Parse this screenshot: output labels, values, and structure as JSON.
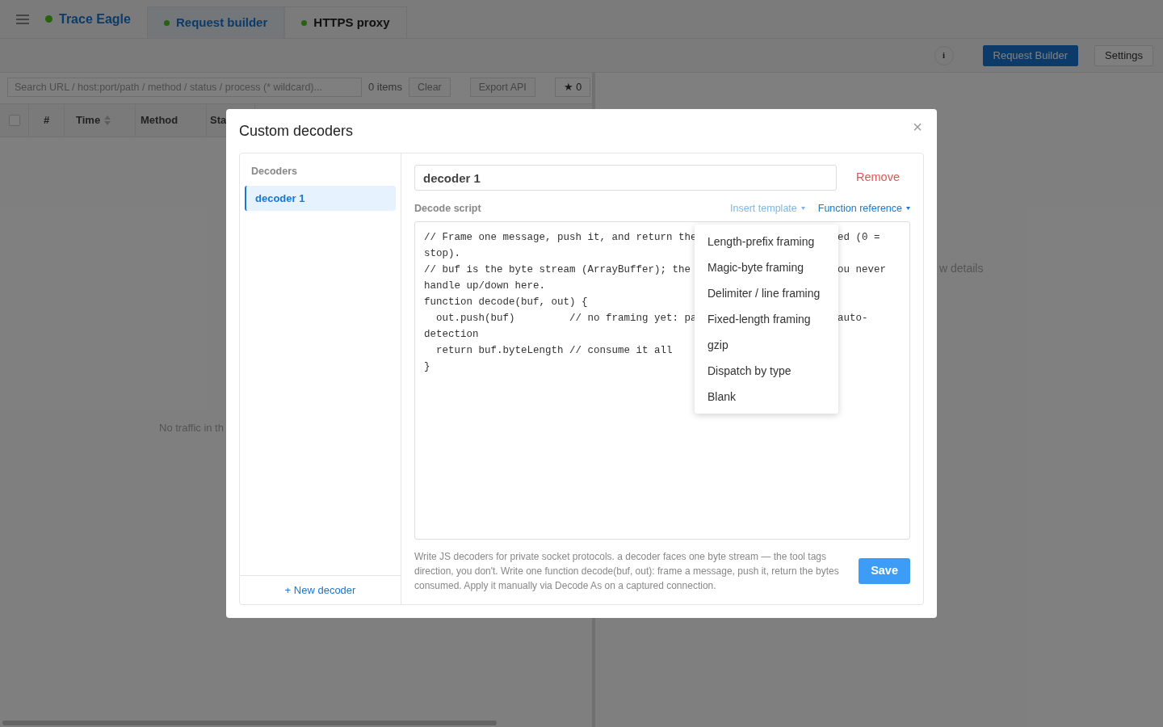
{
  "app": {
    "title": "Trace Eagle"
  },
  "tabs": [
    {
      "label": "Request builder",
      "selected": true
    },
    {
      "label": "HTTPS proxy",
      "selected": false
    }
  ],
  "toolbar": {
    "info": "i",
    "buttons": [
      {
        "label": "Request Builder",
        "kind": "primary"
      },
      {
        "label": "Settings",
        "kind": "default"
      }
    ]
  },
  "traffic": {
    "search": {
      "placeholder": "Search URL / host:port/path / method / status / process (* wildcard)..."
    },
    "count": "0 items",
    "buttons": [
      "Clear",
      "Export API"
    ],
    "star_button": "★ 0",
    "select_all": {
      "checked": false
    },
    "columns": [
      {
        "label": "#",
        "sortable": false
      },
      {
        "label": "Time",
        "sortable": true
      },
      {
        "label": "Method",
        "sortable": false
      },
      {
        "label": "Sta"
      }
    ],
    "empty_text": "No traffic in th"
  },
  "details": {
    "empty_text": "w details"
  },
  "dialog": {
    "title": "Custom decoders",
    "close": "×",
    "sidebar": {
      "heading": "Decoders",
      "items": [
        {
          "label": "decoder 1",
          "selected": true
        }
      ],
      "new_button": "+ New decoder"
    },
    "name_value": "decoder 1",
    "remove": "Remove",
    "script_label": "Decode script",
    "links": [
      {
        "label": "Insert template",
        "expanded": true
      },
      {
        "label": "Function reference",
        "expanded": false
      }
    ],
    "code_lines": [
      {
        "left": "// Frame one message, push it, and return the",
        "right": "ed (0 ="
      },
      {
        "left": "stop)."
      },
      {
        "left": "// buf is the byte stream (ArrayBuffer); the",
        "right": "ou never"
      },
      {
        "left": "handle up/down here."
      },
      {
        "left": "function decode(buf, out) {"
      },
      {
        "left": "  out.push(buf)         // no framing yet: pa",
        "right": "auto-"
      },
      {
        "left": "detection"
      },
      {
        "left": "  return buf.byteLength // consume it all"
      },
      {
        "left": "}"
      }
    ],
    "template_menu": [
      "Length-prefix framing",
      "Magic-byte framing",
      "Delimiter / line framing",
      "Fixed-length framing",
      "gzip",
      "Dispatch by type",
      "Blank"
    ],
    "help": "Write JS decoders for private socket protocols. a decoder faces one byte stream — the tool tags direction, you don't. Write one function decode(buf, out): frame a message, push it, return the bytes consumed. Apply it manually via Decode As on a captured connection.",
    "save": "Save"
  }
}
